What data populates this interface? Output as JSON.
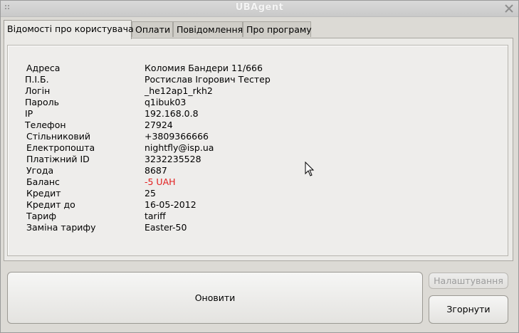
{
  "window": {
    "title": "UBAgent"
  },
  "tabs": [
    {
      "label": "Відомості про користувача",
      "active": true
    },
    {
      "label": "Оплати",
      "active": false
    },
    {
      "label": "Повідомлення",
      "active": false
    },
    {
      "label": "Про програму",
      "active": false
    }
  ],
  "user_info": {
    "rows": [
      {
        "label": "Адреса",
        "value": "Коломия Бандери 11/666"
      },
      {
        "label": "П.І.Б.",
        "value": "Ростислав Ігорович Тестер"
      },
      {
        "label": "Логін",
        "value": "_he12ap1_rkh2"
      },
      {
        "label": "Пароль",
        "value": "q1ibuk03"
      },
      {
        "label": "IP",
        "value": "192.168.0.8"
      },
      {
        "label": "Телефон",
        "value": "27924"
      },
      {
        "label": "Стільниковий",
        "value": "+3809366666"
      },
      {
        "label": "Електропошта",
        "value": "nightfly@isp.ua"
      },
      {
        "label": "Платіжний ID",
        "value": "3232235528"
      },
      {
        "label": "Угода",
        "value": "8687"
      },
      {
        "label": "Баланс",
        "value": "-5 UAH",
        "highlight": "#e21e1e"
      },
      {
        "label": "Кредит",
        "value": "25"
      },
      {
        "label": "Кредит до",
        "value": "16-05-2012"
      },
      {
        "label": "Тариф",
        "value": "tariff"
      },
      {
        "label": "Заміна тарифу",
        "value": "Easter-50"
      }
    ]
  },
  "buttons": {
    "refresh": "Оновити",
    "settings": "Налаштування",
    "minimize": "Згорнути"
  },
  "icons": {
    "close": "close-icon",
    "grip": "grip-icon",
    "cursor": "mouse-pointer-icon"
  }
}
